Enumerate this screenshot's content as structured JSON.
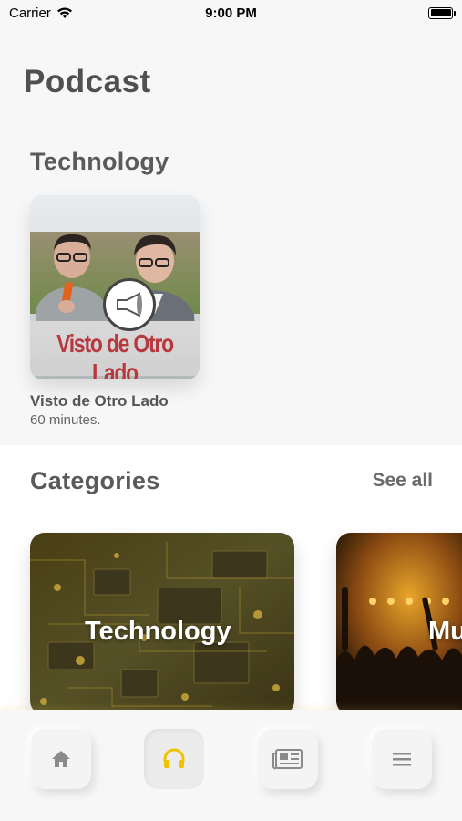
{
  "status_bar": {
    "carrier": "Carrier",
    "time": "9:00 PM"
  },
  "header": {
    "title": "Podcast"
  },
  "featured": {
    "section_title": "Technology",
    "podcast": {
      "cover_text": "Visto de Otro Lado",
      "name": "Visto de Otro Lado",
      "duration": "60 minutes."
    }
  },
  "categories": {
    "title": "Categories",
    "see_all_label": "See all",
    "items": [
      {
        "label": "Technology"
      },
      {
        "label": "Mu"
      }
    ]
  },
  "tab_bar": {
    "items": [
      {
        "icon": "home-icon",
        "active": false
      },
      {
        "icon": "headphones-icon",
        "active": true
      },
      {
        "icon": "news-icon",
        "active": false
      },
      {
        "icon": "menu-icon",
        "active": false
      }
    ],
    "active_color": "#f2c200",
    "inactive_color": "#8a8a8a"
  }
}
